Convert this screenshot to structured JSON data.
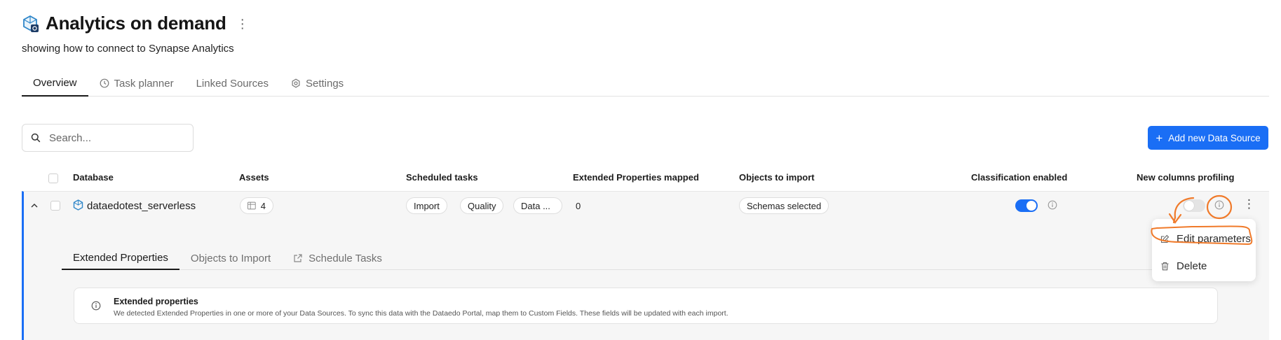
{
  "header": {
    "title": "Analytics on demand",
    "subtitle": "showing how to connect to Synapse Analytics"
  },
  "tabs": [
    {
      "label": "Overview",
      "icon": "none"
    },
    {
      "label": "Task planner",
      "icon": "clock-icon"
    },
    {
      "label": "Linked Sources",
      "icon": "none"
    },
    {
      "label": "Settings",
      "icon": "gear-icon"
    }
  ],
  "search": {
    "placeholder": "Search..."
  },
  "toolbar": {
    "add_label": "Add new Data Source"
  },
  "table": {
    "columns": [
      "Database",
      "Assets",
      "Scheduled tasks",
      "Extended Properties mapped",
      "Objects to import",
      "Classification enabled",
      "New columns profiling"
    ],
    "row": {
      "database": "dataedotest_serverless",
      "assets": "4",
      "tasks": [
        "Import",
        "Quality",
        "Data ..."
      ],
      "extended_mapped": "0",
      "objects": "Schemas selected",
      "classification_enabled": true,
      "profiling_enabled": false
    }
  },
  "sub_tabs": [
    {
      "label": "Extended Properties"
    },
    {
      "label": "Objects to Import"
    },
    {
      "label": "Schedule Tasks"
    }
  ],
  "info": {
    "title": "Extended properties",
    "description": "We detected Extended Properties in one or more of your Data Sources. To sync this data with the Dataedo Portal, map them to Custom Fields. These fields will be updated with each import."
  },
  "menu": {
    "edit": "Edit parameters",
    "delete": "Delete"
  },
  "colors": {
    "accent": "#1a6ef5",
    "annotation": "#f07a2a"
  }
}
